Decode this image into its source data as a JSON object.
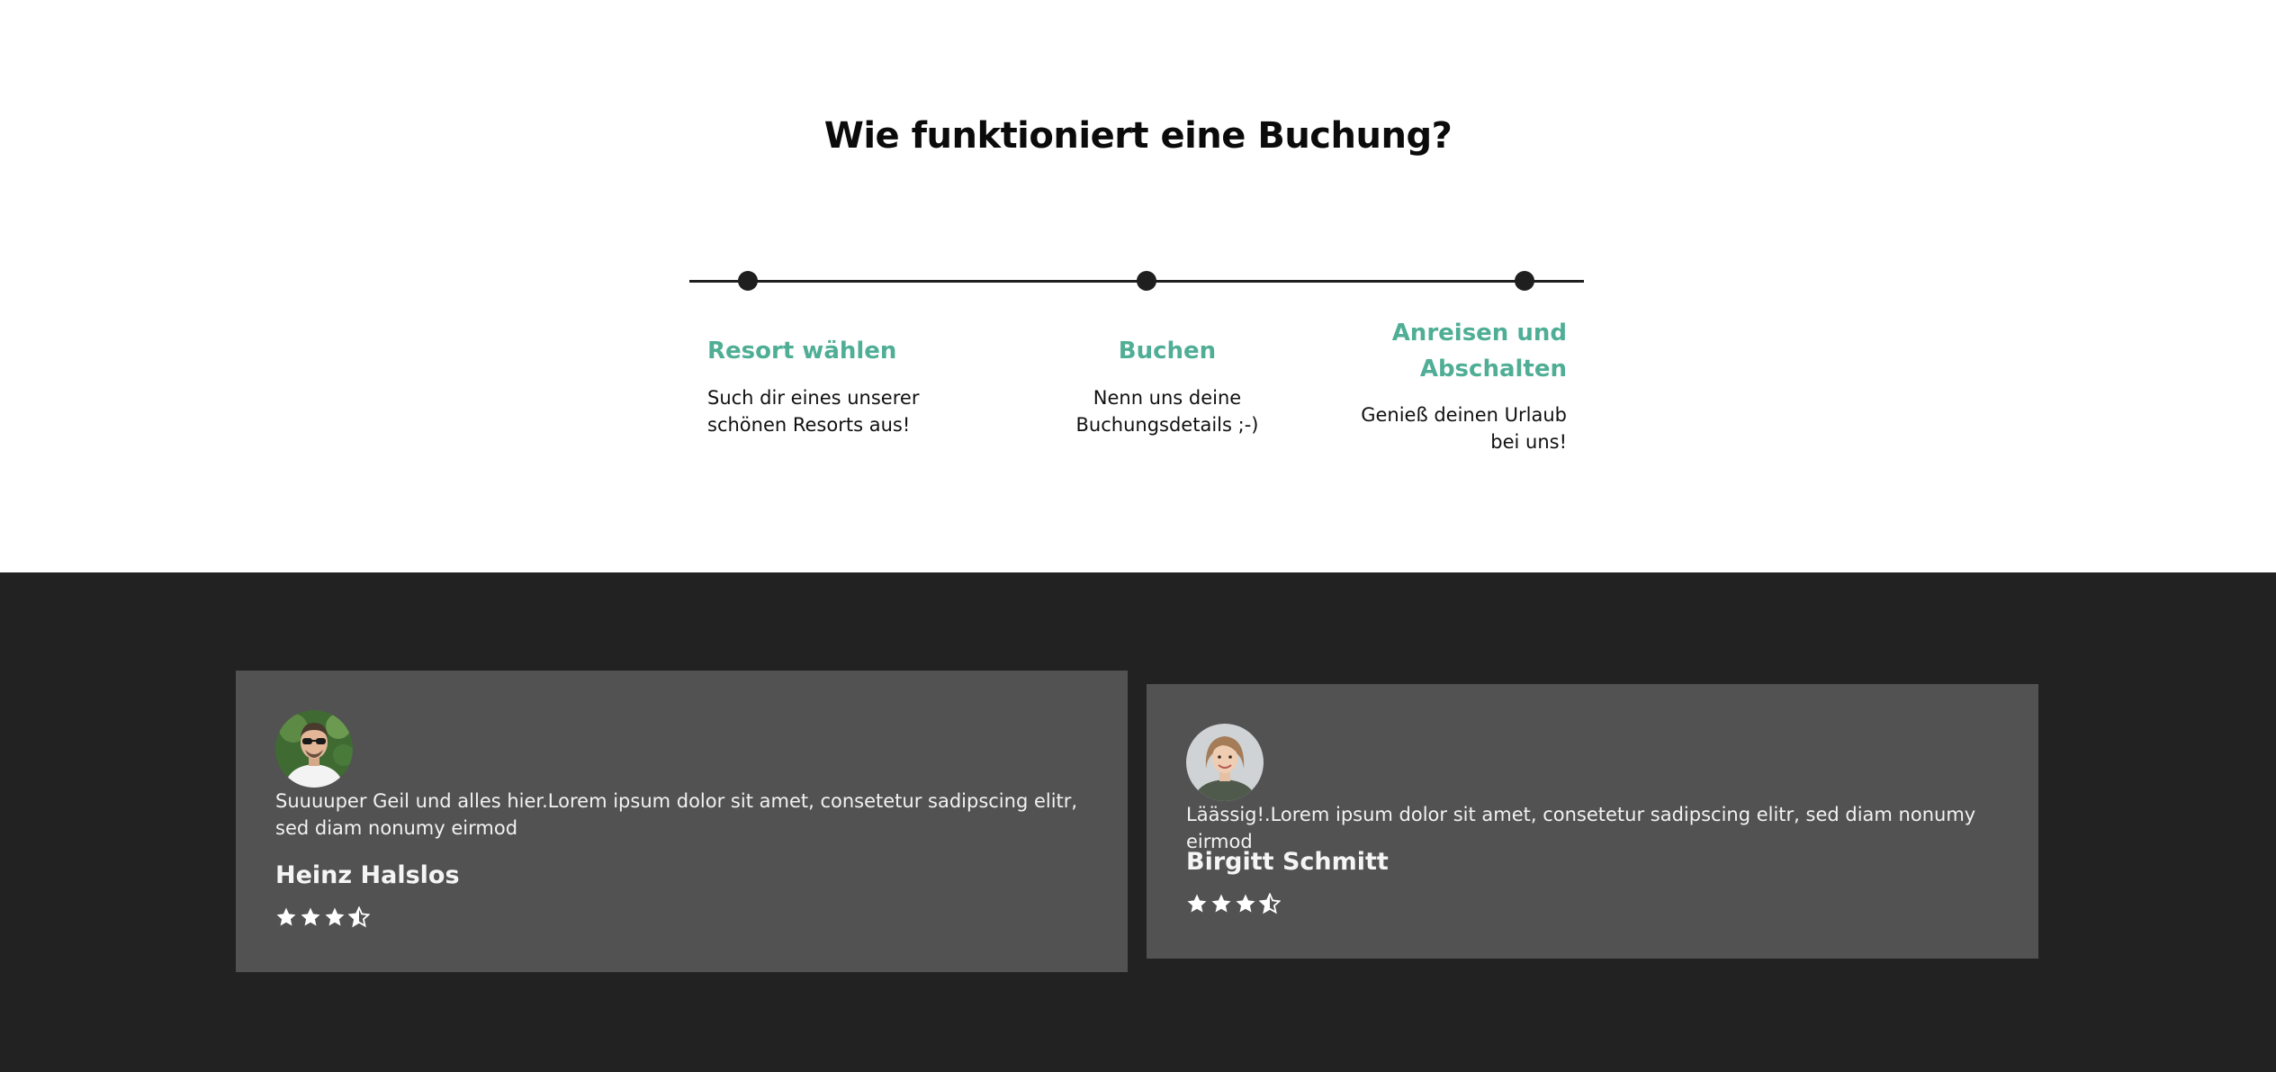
{
  "section": {
    "title": "Wie funktioniert eine Buchung?"
  },
  "steps": [
    {
      "title": "Resort wählen",
      "text": "Such dir eines unserer schönen Resorts aus!"
    },
    {
      "title": "Buchen",
      "text": "Nenn uns deine Buchungsdetails ;-)"
    },
    {
      "title_line1": "Anreisen und",
      "title_line2": "Abschalten",
      "text": "Genieß deinen Urlaub bei uns!"
    }
  ],
  "reviews": [
    {
      "text": "Suuuuper Geil und alles hier.Lorem ipsum dolor sit amet, consetetur sadipscing elitr, sed diam nonumy eirmod",
      "name": "Heinz Halslos",
      "rating": 3.5,
      "avatar_icon": "man-avatar-icon"
    },
    {
      "text": "Läässig!.Lorem ipsum dolor sit amet, consetetur sadipscing elitr, sed diam nonumy eirmod",
      "name": "Birgitt Schmitt",
      "rating": 3.5,
      "avatar_icon": "woman-avatar-icon"
    }
  ],
  "colors": {
    "accent": "#4fae95",
    "dark_bg": "#222222",
    "card_bg": "#525252",
    "line": "#1f1f1f"
  }
}
